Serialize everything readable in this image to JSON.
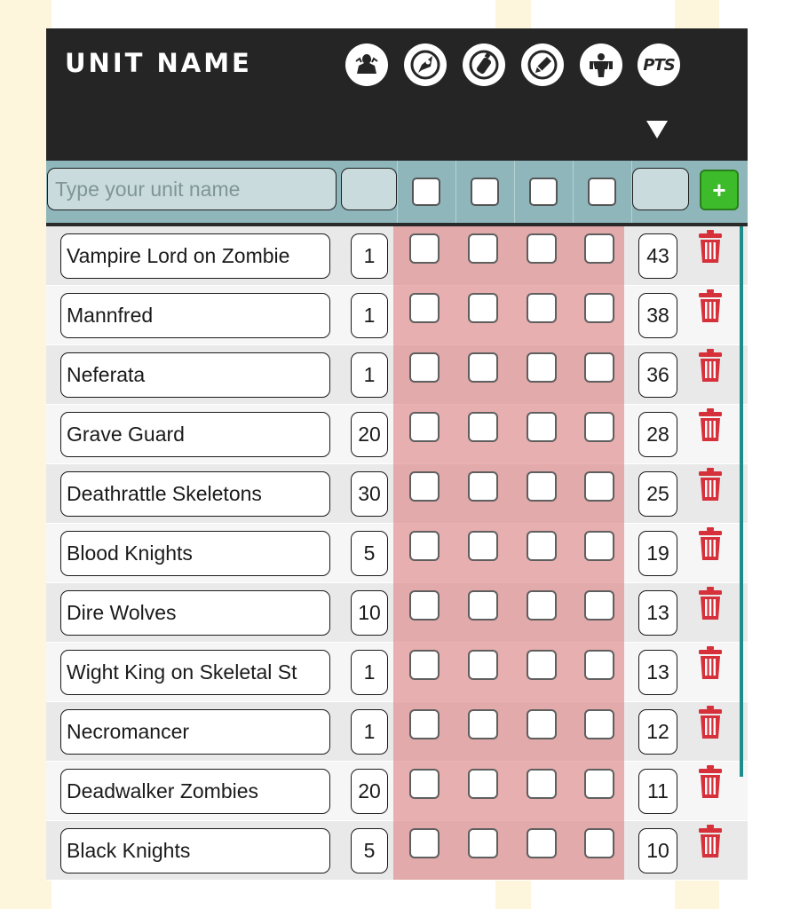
{
  "colors": {
    "header_bg": "#252525",
    "input_row_bg": "#8fb6bb",
    "checkbox_band": "#dd8282",
    "add_button": "#3dbb2a",
    "trash": "#d6303a",
    "scrollbar": "#1f8c8c"
  },
  "header": {
    "title": "UNIT NAME",
    "columns": [
      {
        "icon": "quantity-icon"
      },
      {
        "icon": "rocket-icon"
      },
      {
        "icon": "spray-can-icon"
      },
      {
        "icon": "pencil-icon"
      },
      {
        "icon": "armored-figure-icon"
      },
      {
        "icon": "pts-icon",
        "label": "PTS"
      }
    ],
    "sort_indicator": "sort-descending-icon"
  },
  "input_row": {
    "name_placeholder": "Type your unit name",
    "name_value": "",
    "quantity_value": "",
    "points_value": "",
    "add_label": "+"
  },
  "units": [
    {
      "name": "Vampire Lord on Zombie",
      "qty": "1",
      "pts": "43"
    },
    {
      "name": "Mannfred",
      "qty": "1",
      "pts": "38"
    },
    {
      "name": "Neferata",
      "qty": "1",
      "pts": "36"
    },
    {
      "name": "Grave Guard",
      "qty": "20",
      "pts": "28"
    },
    {
      "name": "Deathrattle Skeletons",
      "qty": "30",
      "pts": "25"
    },
    {
      "name": "Blood Knights",
      "qty": "5",
      "pts": "19"
    },
    {
      "name": "Dire Wolves",
      "qty": "10",
      "pts": "13"
    },
    {
      "name": "Wight King on Skeletal St",
      "qty": "1",
      "pts": "13"
    },
    {
      "name": "Necromancer",
      "qty": "1",
      "pts": "12"
    },
    {
      "name": "Deadwalker Zombies",
      "qty": "20",
      "pts": "11"
    },
    {
      "name": "Black Knights",
      "qty": "5",
      "pts": "10"
    }
  ]
}
